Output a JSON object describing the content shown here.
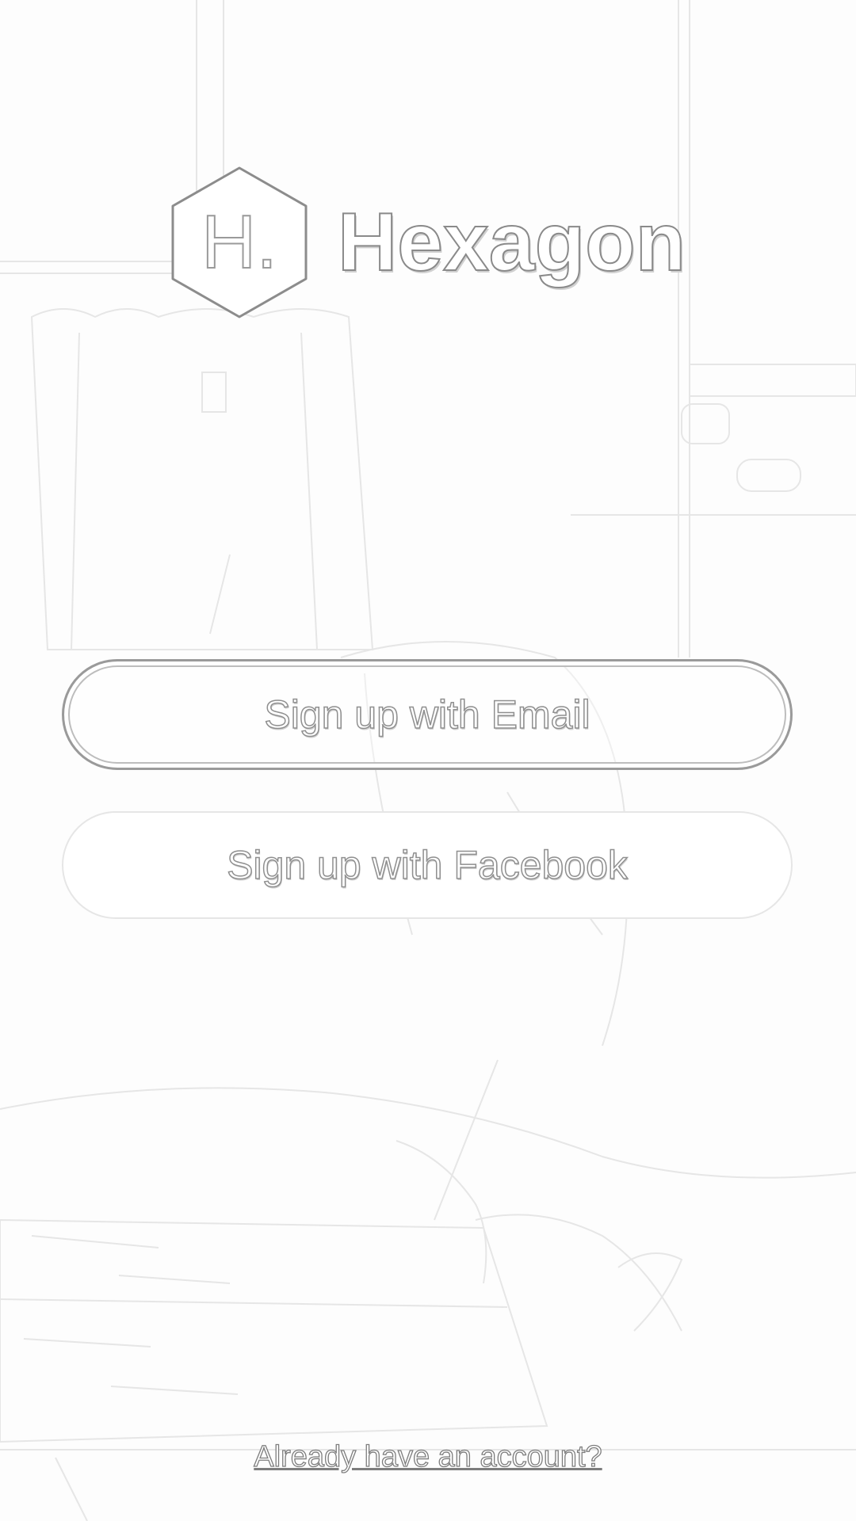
{
  "app": {
    "logo_letter": "H.",
    "logo_name": "Hexagon"
  },
  "actions": {
    "signup_email_label": "Sign up with Email",
    "signup_facebook_label": "Sign up with Facebook",
    "login_link_label": "Already have an account?"
  },
  "colors": {
    "outline": "#9a9a9a",
    "background": "#fdfdfd"
  }
}
